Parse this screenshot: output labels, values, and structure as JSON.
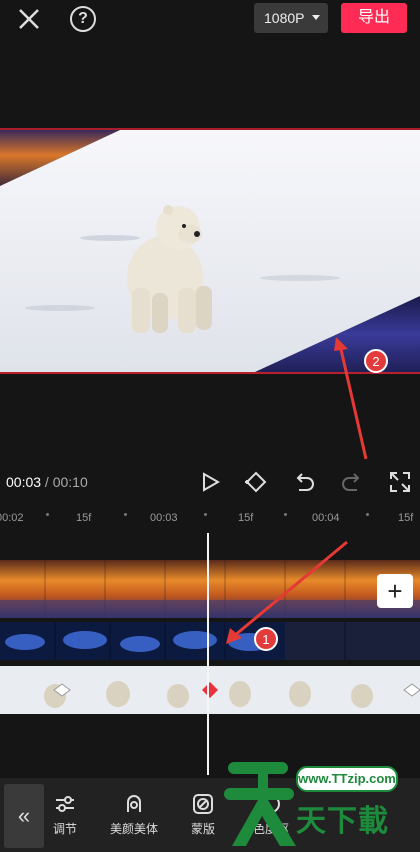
{
  "top_bar": {
    "close_icon": "close-icon",
    "help_icon": "help-icon",
    "help_glyph": "?",
    "resolution": "1080P",
    "export_label": "导出"
  },
  "playback": {
    "current_time": "00:03",
    "separator": " / ",
    "total_time": "00:10",
    "icons": [
      "play-icon",
      "keyframe-icon",
      "undo-icon",
      "redo-icon",
      "fullscreen-icon"
    ]
  },
  "ruler": {
    "labels": [
      "00:02",
      "15f",
      "00:03",
      "15f",
      "00:04",
      "15f"
    ]
  },
  "annotations": {
    "marker_1": "1",
    "marker_2": "2",
    "arrow_color": "#e53935"
  },
  "add_label": "+",
  "toolbar": {
    "collapse_glyph": "«",
    "items": [
      {
        "label": "调节",
        "icon": "adjust-sliders-icon"
      },
      {
        "label": "美颜美体",
        "icon": "beauty-face-icon"
      },
      {
        "label": "蒙版",
        "icon": "mask-icon"
      },
      {
        "label": "色度抠",
        "icon": "chroma-key-icon"
      }
    ]
  },
  "site_logo": {
    "url": "www.TTzip.com",
    "name": "天下載",
    "brand_color": "#1e8a3c"
  },
  "colors": {
    "accent": "#fe2c55",
    "background": "#151515"
  }
}
